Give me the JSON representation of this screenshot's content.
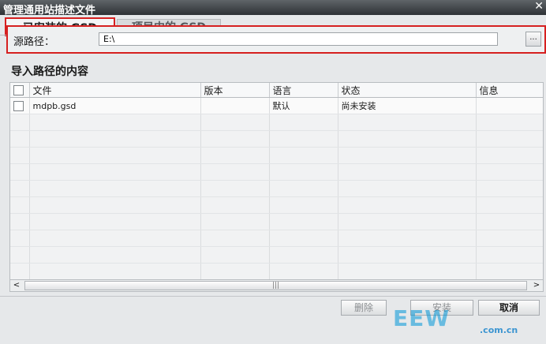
{
  "window": {
    "title": "管理通用站描述文件",
    "close_glyph": "✕"
  },
  "tabs": [
    {
      "label": "已安装的 GSD",
      "active": true
    },
    {
      "label": "项目中的 GSD",
      "active": false
    }
  ],
  "source": {
    "label": "源路径：",
    "value": "E:\\",
    "browse_label": "..."
  },
  "section": {
    "title": "导入路径的内容"
  },
  "table": {
    "columns": [
      "文件",
      "版本",
      "语言",
      "状态",
      "信息"
    ],
    "rows": [
      {
        "file": "mdpb.gsd",
        "version": "",
        "language": "默认",
        "status": "尚未安装",
        "info": ""
      }
    ],
    "empty_rows": 10
  },
  "scrollbar": {
    "left_glyph": "<",
    "right_glyph": ">",
    "grip_glyph": "|||"
  },
  "buttons": {
    "delete": "删除",
    "install": "安装",
    "cancel": "取消"
  },
  "watermark": {
    "big": "EEW",
    "small": ".com.cn"
  },
  "colors": {
    "highlight_border": "#d62020",
    "titlebar": "#3a3e42",
    "watermark": "#0096d7"
  }
}
